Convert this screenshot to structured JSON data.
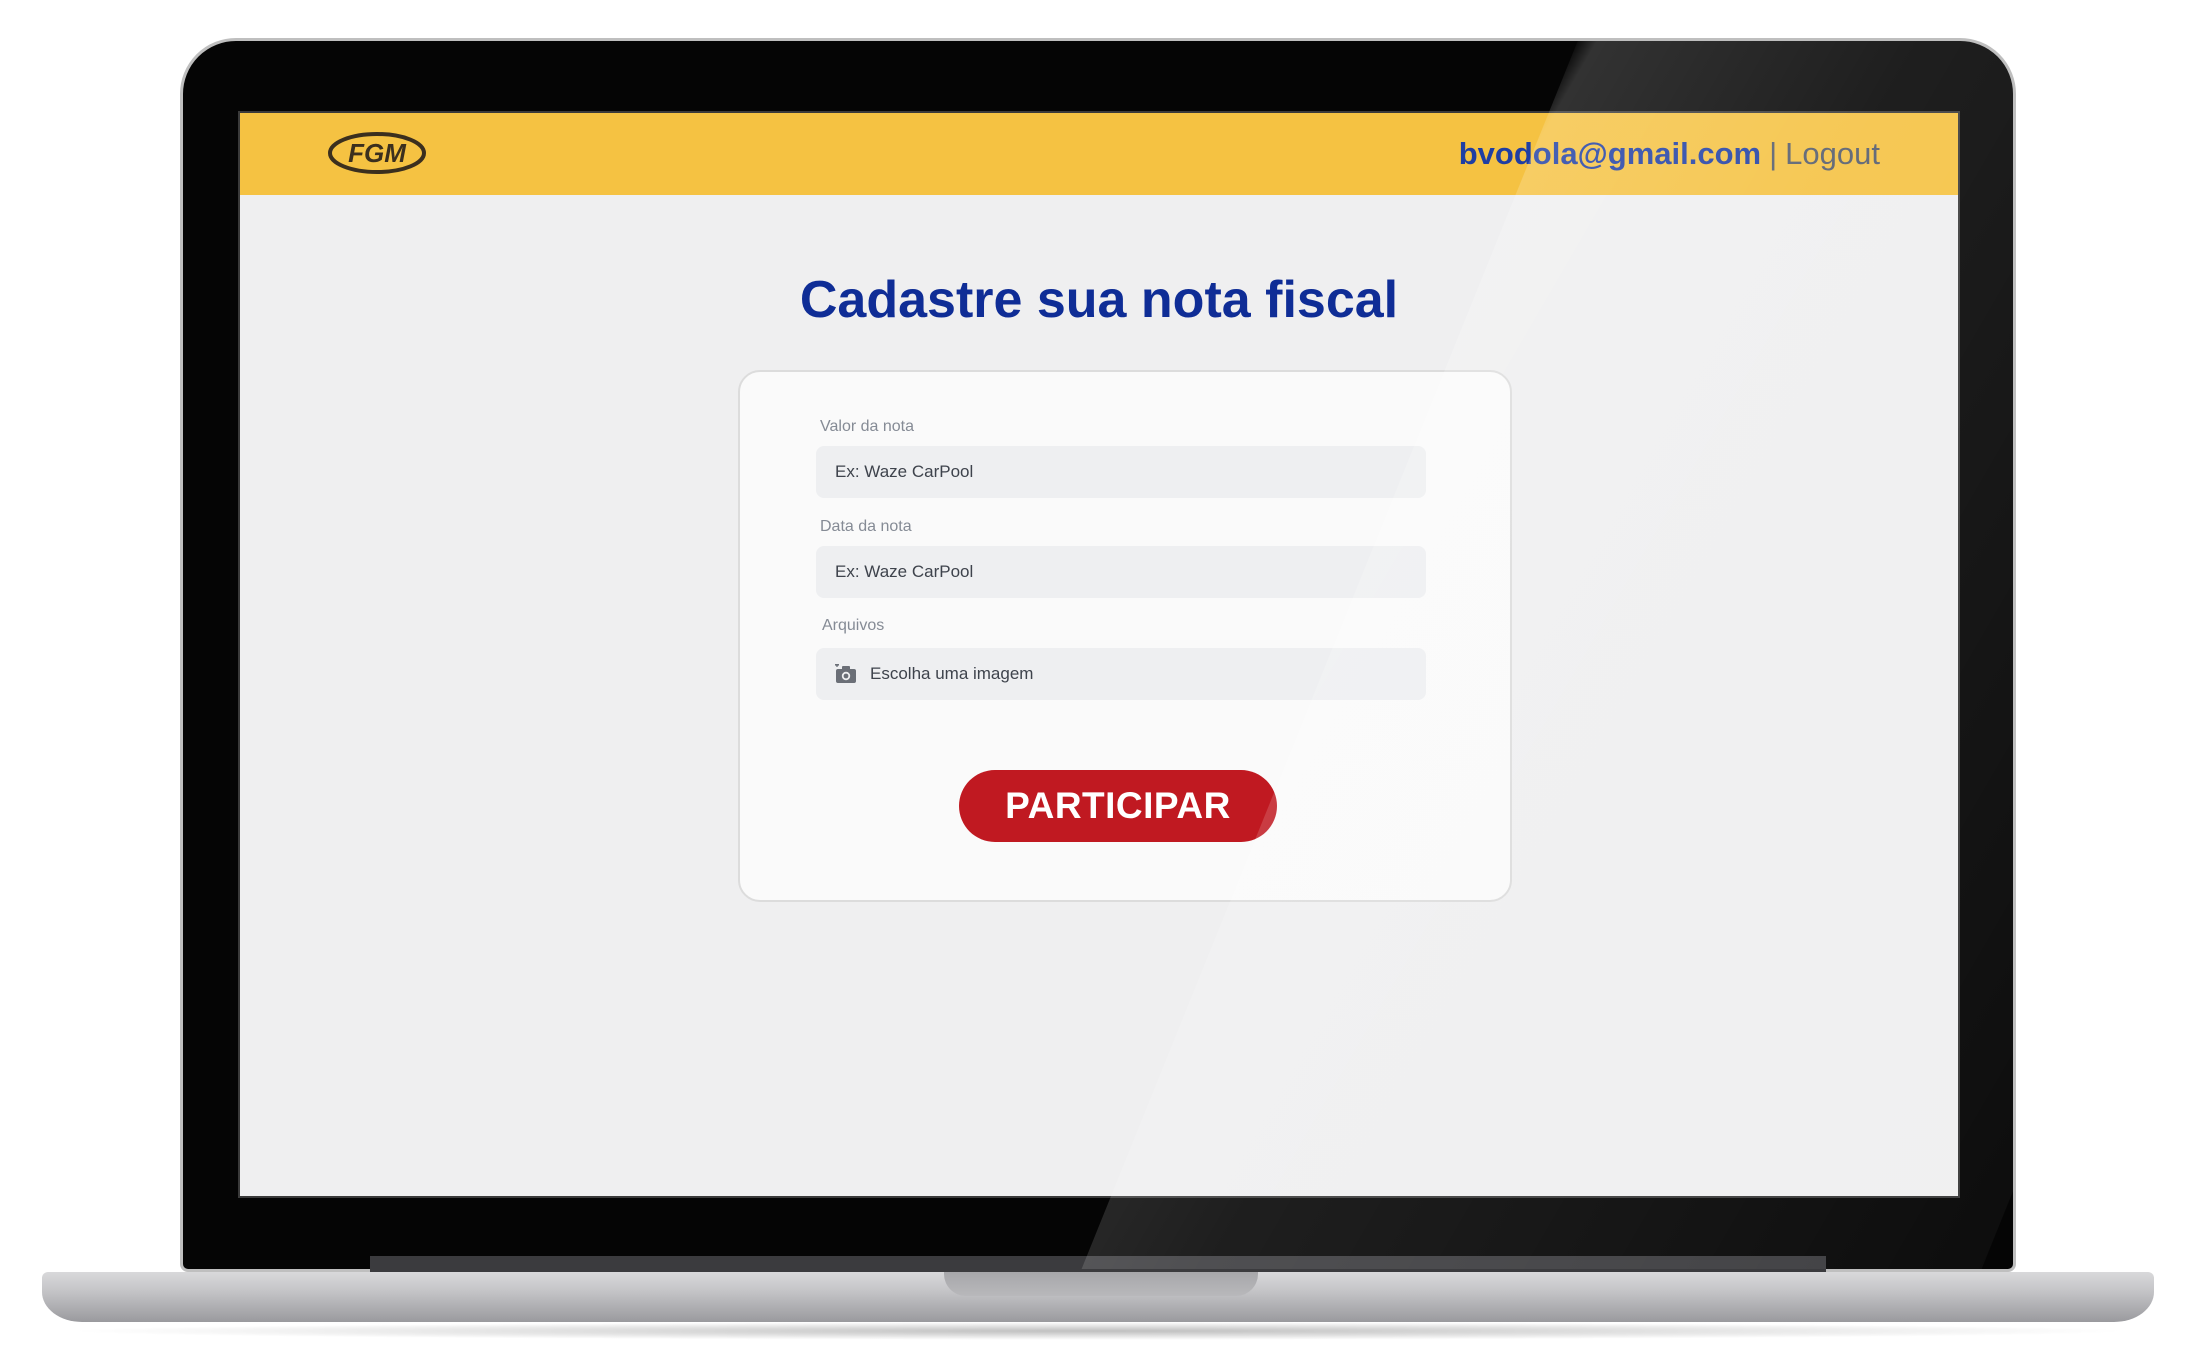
{
  "header": {
    "brand": "FGM",
    "email": "bvodola@gmail.com",
    "separator": "|",
    "logout_label": "Logout"
  },
  "main": {
    "title": "Cadastre sua nota fiscal"
  },
  "form": {
    "valor": {
      "label": "Valor da nota",
      "placeholder": "Ex: Waze CarPool"
    },
    "data": {
      "label": "Data da nota",
      "placeholder": "Ex: Waze CarPool"
    },
    "arquivos": {
      "label": "Arquivos",
      "placeholder": "Escolha uma imagem",
      "icon": "camera-icon"
    },
    "submit_label": "PARTICIPAR"
  },
  "colors": {
    "header_bg": "#f5c242",
    "title": "#0f2d96",
    "email": "#1f3ea3",
    "button": "#c01921"
  }
}
